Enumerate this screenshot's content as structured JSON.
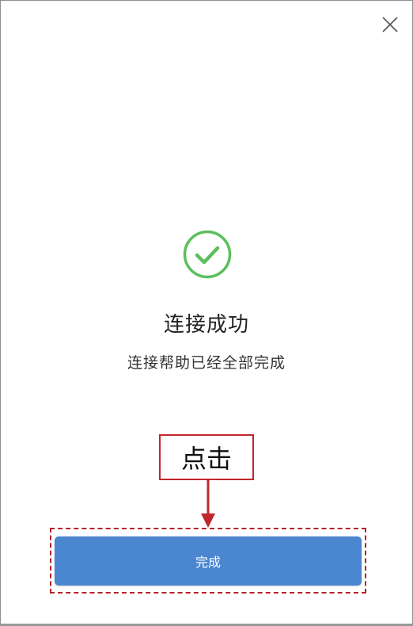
{
  "dialog": {
    "close_icon": "close-icon",
    "success_icon": "check-circle-icon",
    "title": "连接成功",
    "subtitle": "连接帮助已经全部完成",
    "done_button_label": "完成"
  },
  "annotation": {
    "callout_text": "点击",
    "arrow_icon": "down-arrow-icon"
  },
  "colors": {
    "success_green": "#5cbf5c",
    "button_blue": "#4b86d0",
    "annotation_red": "#c0272d"
  }
}
